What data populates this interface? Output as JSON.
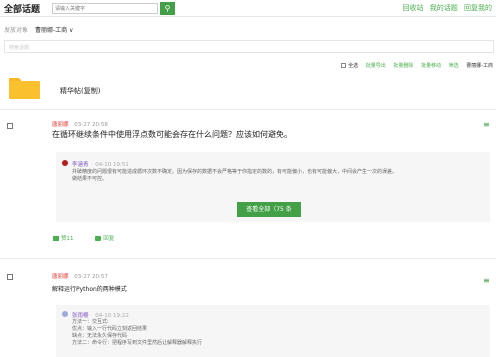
{
  "header": {
    "title": "全部话题",
    "search_placeholder": "请输入关键字",
    "search_icon": "search-icon",
    "links": [
      "回收站",
      "我的话题",
      "回复我的"
    ]
  },
  "filter": {
    "label": "发放对象",
    "value": "曹丽娜-工商 ∨"
  },
  "search_panel": {
    "placeholder": "搜索话题"
  },
  "toolbar": {
    "select_all": "全选",
    "batch_export": "批量导出",
    "batch_delete": "批量删除",
    "batch_move": "批量移动",
    "filter": "筛选",
    "owner": "曹丽娜-工商"
  },
  "folder": {
    "name": "精华帖(复制)"
  },
  "posts": [
    {
      "author": "唐丽娜",
      "time": "03-27 20:58",
      "title": "在循环继续条件中使用浮点数可能会存在什么问题？应该如何避免。",
      "answer": {
        "author": "李涵青",
        "time": "04-10 19:51",
        "lines": [
          "并破精度的问题很有可能造成循环次数不确定。因为保存的数据不会严格等于你指定的数的，有可能偏小，也有可能偏大，中间会产生一次的误差。",
          "做结果不可控。"
        ]
      },
      "view_all": "查看全部（75 条",
      "like_count": "赞11",
      "reply_label": "回复"
    },
    {
      "author": "唐丽娜",
      "time": "03-27 20:57",
      "title": "解释运行Python的两种模式",
      "answer": {
        "author": "张雨樱",
        "time": "04-10 19:22",
        "lines": [
          "方法一：交互式:",
          "优点：输入一行代码立刻返回结果",
          "缺点：无法永久保存代码",
          "方法二：命令行：把程序写到文件里然后让解释器解释执行"
        ]
      }
    }
  ],
  "colors": {
    "accent": "#43a047",
    "author": "#e53935",
    "answerer": "#7e57c2",
    "folder": "#fbc02d"
  }
}
